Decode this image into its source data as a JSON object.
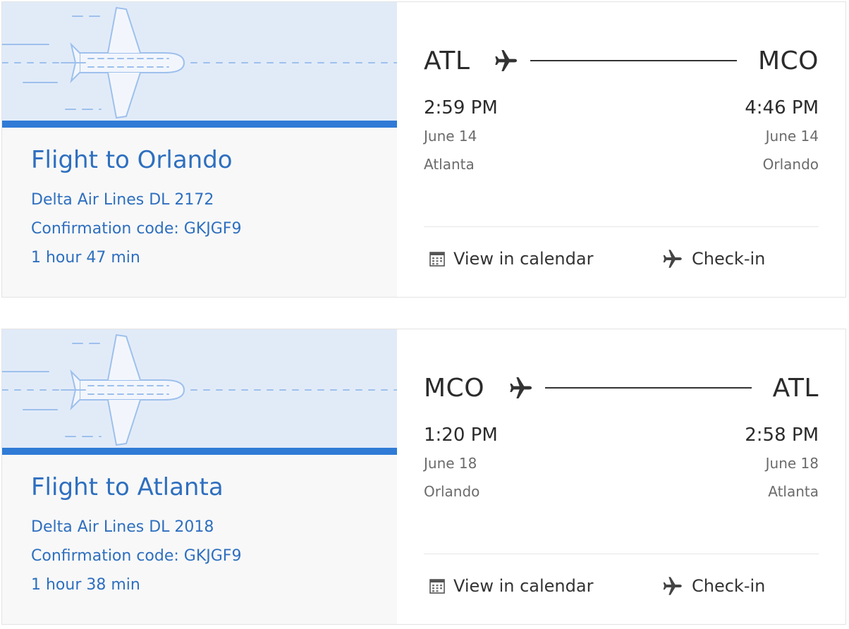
{
  "flights": [
    {
      "title": "Flight to Orlando",
      "airline": "Delta Air Lines DL 2172",
      "confirmation": "Confirmation code: GKJGF9",
      "duration": "1 hour 47 min",
      "origin": {
        "code": "ATL",
        "time": "2:59 PM",
        "date": "June 14",
        "city": "Atlanta"
      },
      "destination": {
        "code": "MCO",
        "time": "4:46 PM",
        "date": "June 14",
        "city": "Orlando"
      },
      "actions": {
        "calendar": "View in calendar",
        "checkin": "Check-in"
      }
    },
    {
      "title": "Flight to Atlanta",
      "airline": "Delta Air Lines DL 2018",
      "confirmation": "Confirmation code: GKJGF9",
      "duration": "1 hour 38 min",
      "origin": {
        "code": "MCO",
        "time": "1:20 PM",
        "date": "June 18",
        "city": "Orlando"
      },
      "destination": {
        "code": "ATL",
        "time": "2:58 PM",
        "date": "June 18",
        "city": "Atlanta"
      },
      "actions": {
        "calendar": "View in calendar",
        "checkin": "Check-in"
      }
    }
  ],
  "colors": {
    "accent": "#2f7bd6",
    "title_text": "#2e6fbf",
    "banner_bg": "#e1ebf8"
  },
  "icons": {
    "banner": "airplane-illustration-icon",
    "route": "airplane-icon",
    "calendar": "calendar-icon",
    "checkin": "airplane-icon"
  }
}
